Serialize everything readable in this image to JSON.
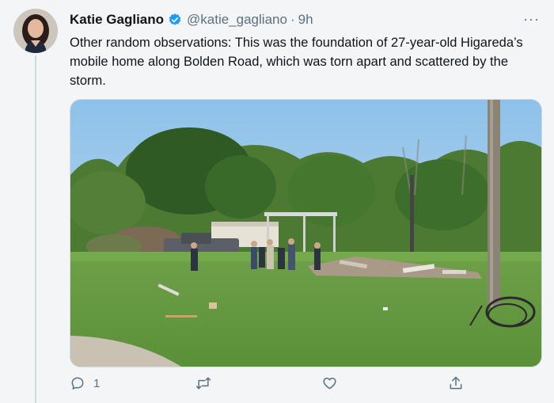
{
  "tweet": {
    "author_name": "Katie Gagliano",
    "handle": "@katie_gagliano",
    "separator": "·",
    "time": "9h",
    "more_label": "···",
    "text": "Other random observations: This was the foundation of 27-year-old Higareda’s mobile home along Bolden Road, which was torn apart and scattered by the storm."
  },
  "icons": {
    "verified": "verified-badge-icon",
    "reply": "reply-icon",
    "retweet": "retweet-icon",
    "like": "heart-icon",
    "share": "share-icon",
    "more": "more-icon"
  },
  "actions": {
    "reply_count": "1",
    "retweet_count": "",
    "like_count": ""
  },
  "colors": {
    "verified_blue": "#1d9bf0",
    "icon_gray": "#5b7083",
    "text": "#0f1419"
  }
}
